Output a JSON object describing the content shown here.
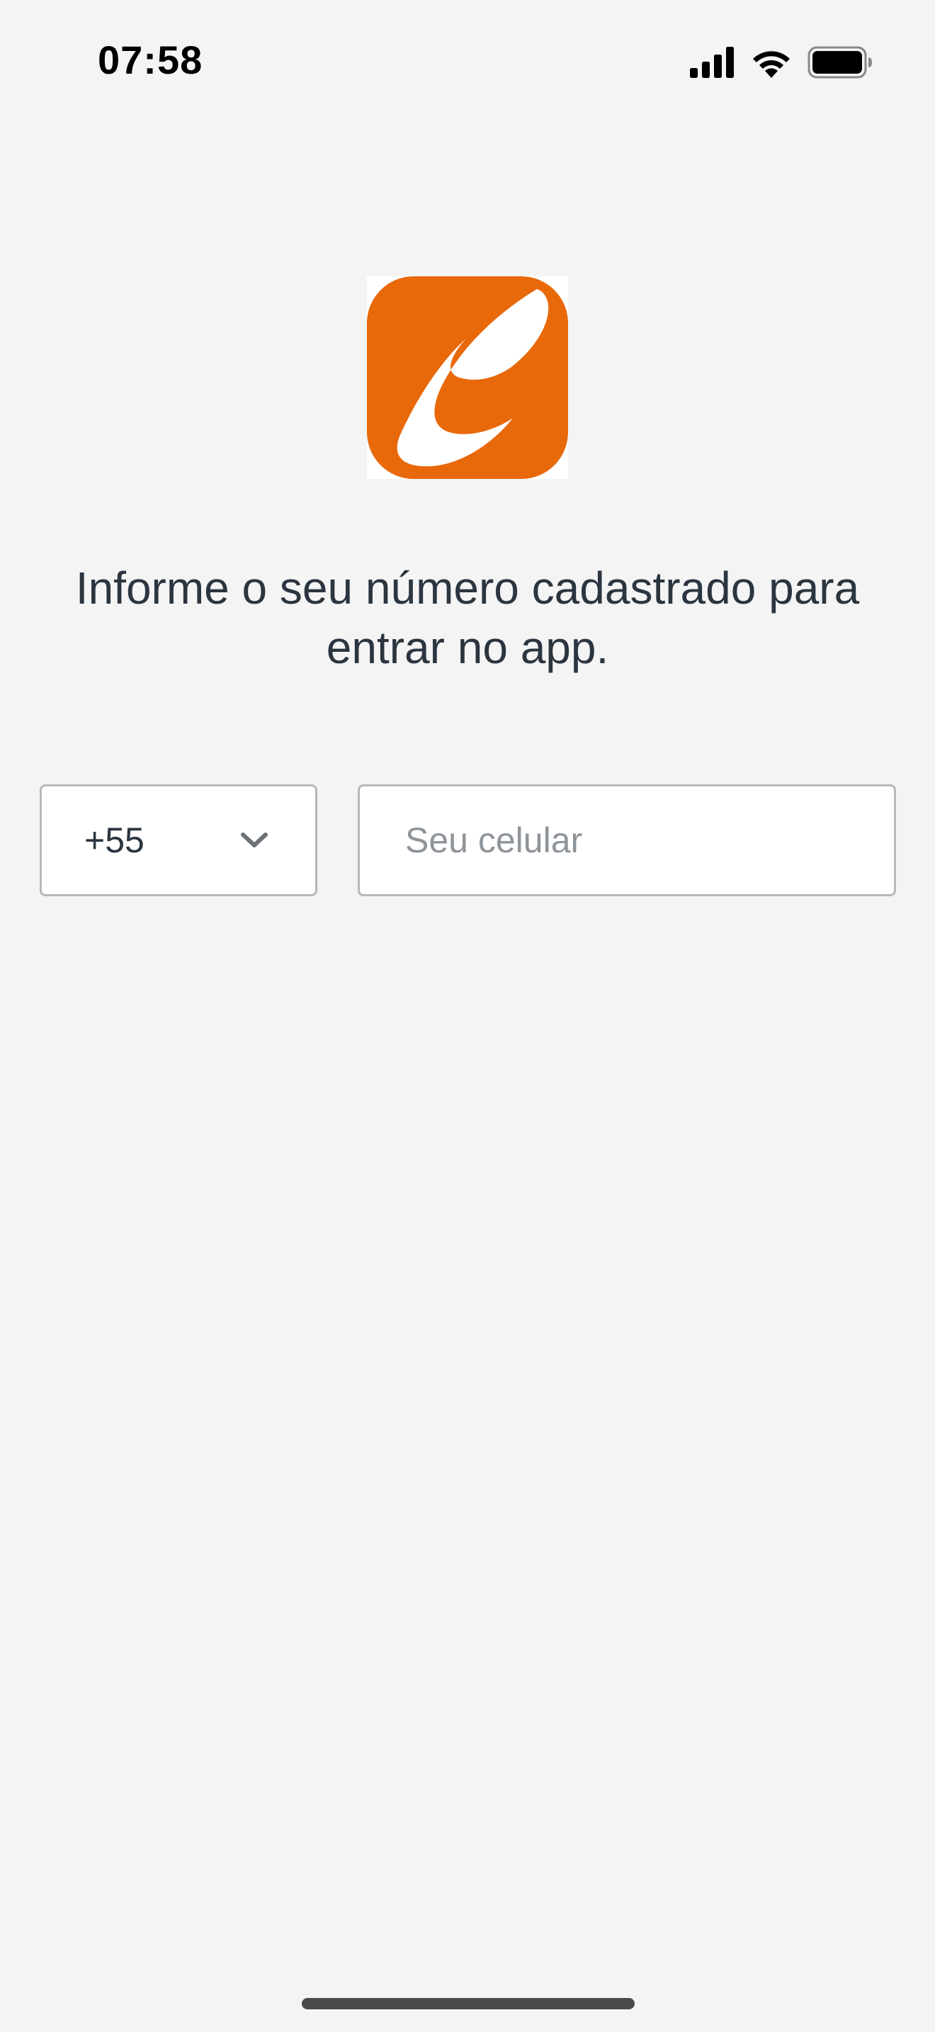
{
  "status_bar": {
    "time": "07:58",
    "icons": [
      "cellular-signal-icon",
      "wifi-icon",
      "battery-icon"
    ]
  },
  "logo": {
    "icon": "app-logo",
    "brand_color": "#E8690A"
  },
  "instruction": {
    "text": "Informe o seu número cadastrado para entrar no app."
  },
  "phone_form": {
    "country_code": "+55",
    "country_icon": "chevron-down-icon",
    "phone_value": "",
    "phone_placeholder": "Seu celular"
  }
}
